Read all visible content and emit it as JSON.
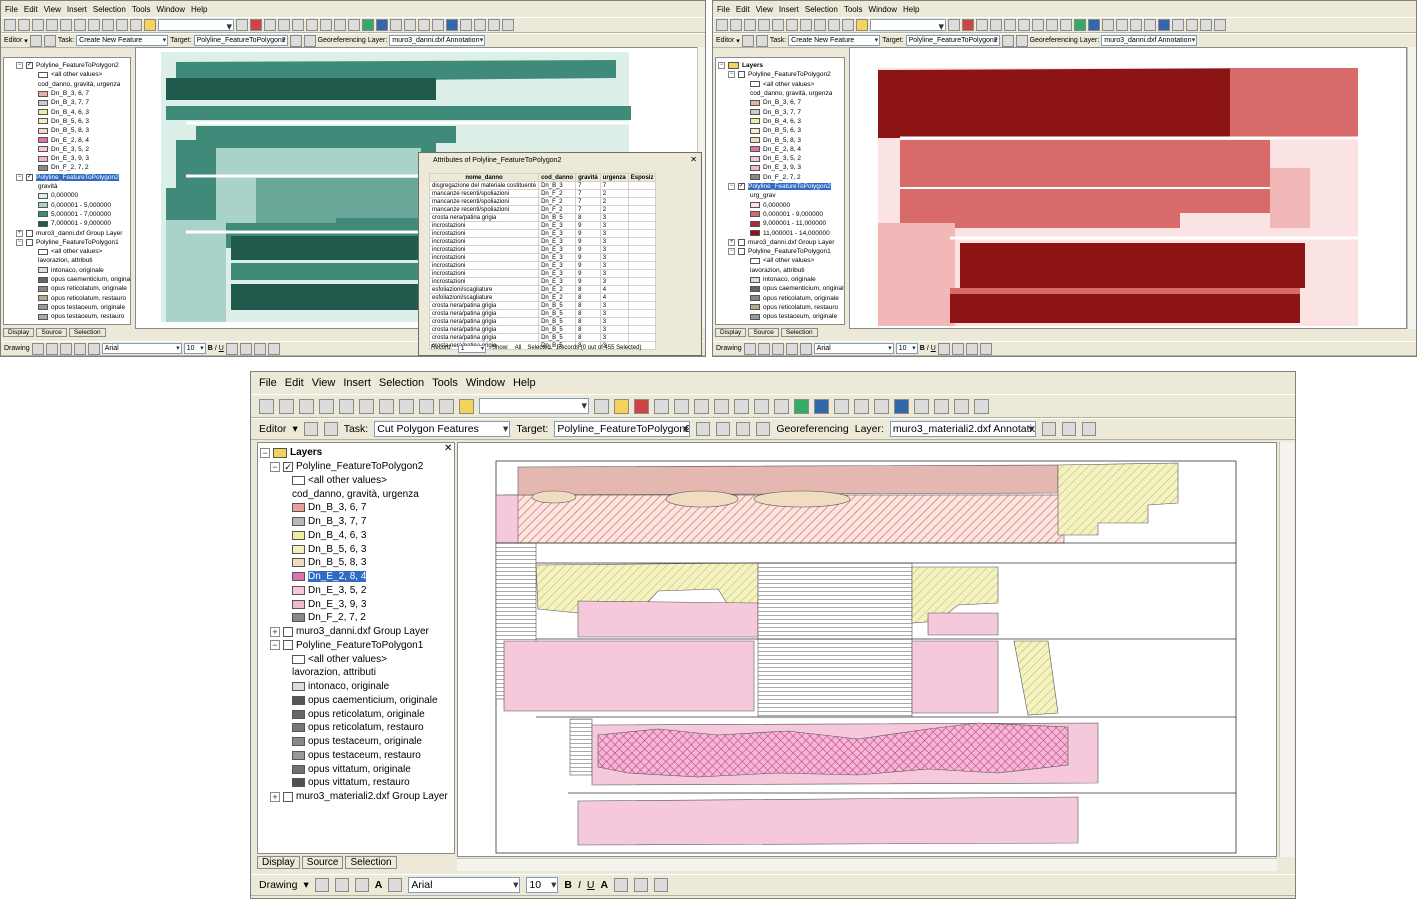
{
  "menu": [
    "File",
    "Edit",
    "View",
    "Insert",
    "Selection",
    "Tools",
    "Window",
    "Help"
  ],
  "colors": {
    "teal_dark": "#1f5a4c",
    "teal_mid": "#3f8a78",
    "teal_light": "#a9d3c9",
    "teal_pale": "#dcefe9",
    "red_dark": "#8c1414",
    "red_mid": "#d96a6a",
    "red_light": "#f2b8b8",
    "red_pale": "#fbe3e3",
    "pink": "#f6c8dc",
    "magenta": "#d0408c",
    "yellow": "#efeda0",
    "tan": "#f0dcc0",
    "hatch_red": "#d8746c"
  },
  "icons": [
    "new-icon",
    "open-icon",
    "save-icon",
    "print-icon",
    "cut-icon",
    "copy-icon",
    "paste-icon",
    "delete-icon",
    "undo-icon",
    "redo-icon",
    "add-data-icon",
    "editor-toolbar-icon",
    "arctoolbox-icon",
    "python-icon",
    "whats-this-icon",
    "zoom-in-icon",
    "zoom-out-icon",
    "fixed-zoom-in-icon",
    "fixed-zoom-out-icon",
    "pan-icon",
    "full-extent-icon",
    "back-icon",
    "forward-icon",
    "select-features-icon",
    "clear-selection-icon",
    "select-elements-icon",
    "identify-icon",
    "find-icon",
    "go-to-xy-icon",
    "measure-icon",
    "hyperlink-icon"
  ],
  "top_left": {
    "editor_label": "Editor",
    "task_label": "Task:",
    "task_value": "Create New Feature",
    "target_label": "Target:",
    "target_value": "Polyline_FeatureToPolygon2",
    "georef": "Georeferencing",
    "layer_label": "Layer:",
    "layer_value": "muro3_danni.dxf Annotation",
    "toc": [
      {
        "label": "Polyline_FeatureToPolygon2",
        "kind": "group",
        "expand": "−",
        "checked": true
      },
      {
        "label": "<all other values>",
        "kind": "sym",
        "color": "#ffffff"
      },
      {
        "label": "cod_danno, gravità, urgenza",
        "kind": "text"
      },
      {
        "label": "Dn_B_3, 6, 7",
        "kind": "sym",
        "color": "#e8b0a8"
      },
      {
        "label": "Dn_B_3, 7, 7",
        "kind": "sym",
        "color": "#cccccc"
      },
      {
        "label": "Dn_B_4, 6, 3",
        "kind": "sym",
        "color": "#efeda0"
      },
      {
        "label": "Dn_B_5, 6, 3",
        "kind": "sym",
        "color": "#f4eec0"
      },
      {
        "label": "Dn_B_5, 8, 3",
        "kind": "sym",
        "color": "#f0dcc0"
      },
      {
        "label": "Dn_E_2, 8, 4",
        "kind": "sym",
        "color": "#e070a8"
      },
      {
        "label": "Dn_E_3, 5, 2",
        "kind": "sym",
        "color": "#f6c8dc"
      },
      {
        "label": "Dn_E_3, 9, 3",
        "kind": "sym",
        "color": "#f2b8cc"
      },
      {
        "label": "Dn_F_2, 7, 2",
        "kind": "sym",
        "color": "#888888"
      },
      {
        "label": "Polyline_FeatureToPolygon2",
        "kind": "group",
        "expand": "−",
        "checked": true,
        "selected": true
      },
      {
        "label": "gravità",
        "kind": "text"
      },
      {
        "label": "0,000000",
        "kind": "sym",
        "color": "#dcefe9"
      },
      {
        "label": "0,000001 - 5,000000",
        "kind": "sym",
        "color": "#a9d3c9"
      },
      {
        "label": "5,000001 - 7,000000",
        "kind": "sym",
        "color": "#3f8a78"
      },
      {
        "label": "7,000001 - 9,000000",
        "kind": "sym",
        "color": "#1f5a4c"
      },
      {
        "label": "muro3_danni.dxf Group Layer",
        "kind": "group",
        "expand": "+",
        "checked": false
      },
      {
        "label": "Polyline_FeatureToPolygon1",
        "kind": "group",
        "expand": "−",
        "checked": false
      },
      {
        "label": "<all other values>",
        "kind": "sym",
        "color": "#ffffff"
      },
      {
        "label": "lavorazion, attributi",
        "kind": "text"
      },
      {
        "label": "intonaco, originale",
        "kind": "sym",
        "color": "#dddddd"
      },
      {
        "label": "opus caementicium, originale",
        "kind": "sym",
        "color": "#666666"
      },
      {
        "label": "opus reticolatum, originale",
        "kind": "sym",
        "color": "#888888"
      },
      {
        "label": "opus reticolatum, restauro",
        "kind": "sym",
        "color": "#b8a890"
      },
      {
        "label": "opus testaceum, originale",
        "kind": "sym",
        "color": "#999999"
      },
      {
        "label": "opus testaceum, restauro",
        "kind": "sym",
        "color": "#aaaaaa"
      }
    ],
    "tabs": [
      "Display",
      "Source",
      "Selection"
    ],
    "drawing_label": "Drawing",
    "font_value": "Arial",
    "size_value": "10"
  },
  "attributes": {
    "title": "Attributes of Polyline_FeatureToPolygon2",
    "columns": [
      "nome_danno",
      "cod_danno",
      "gravità",
      "urgenza",
      "Esposiz"
    ],
    "rows": [
      [
        "disgregazione del materiale costituente",
        "Dn_B_3",
        "7",
        "7",
        ""
      ],
      [
        "mancanze recenti/spoliazioni",
        "Dn_F_2",
        "7",
        "2",
        ""
      ],
      [
        "mancanze recenti/spoliazioni",
        "Dn_F_2",
        "7",
        "2",
        ""
      ],
      [
        "mancanze recenti/spoliazioni",
        "Dn_F_2",
        "7",
        "2",
        ""
      ],
      [
        "crosta nera/patina grigia",
        "Dn_B_5",
        "8",
        "3",
        ""
      ],
      [
        "incrostazioni",
        "Dn_E_3",
        "9",
        "3",
        ""
      ],
      [
        "incrostazioni",
        "Dn_E_3",
        "9",
        "3",
        ""
      ],
      [
        "incrostazioni",
        "Dn_E_3",
        "9",
        "3",
        ""
      ],
      [
        "incrostazioni",
        "Dn_E_3",
        "9",
        "3",
        ""
      ],
      [
        "incrostazioni",
        "Dn_E_3",
        "9",
        "3",
        ""
      ],
      [
        "incrostazioni",
        "Dn_E_3",
        "9",
        "3",
        ""
      ],
      [
        "incrostazioni",
        "Dn_E_3",
        "9",
        "3",
        ""
      ],
      [
        "incrostazioni",
        "Dn_E_3",
        "9",
        "3",
        ""
      ],
      [
        "esfoliazioni/scagliature",
        "Dn_E_2",
        "8",
        "4",
        ""
      ],
      [
        "esfoliazioni/scagliature",
        "Dn_E_2",
        "8",
        "4",
        ""
      ],
      [
        "crosta nera/patina grigia",
        "Dn_B_5",
        "8",
        "3",
        ""
      ],
      [
        "crosta nera/patina grigia",
        "Dn_B_5",
        "8",
        "3",
        ""
      ],
      [
        "crosta nera/patina grigia",
        "Dn_B_5",
        "8",
        "3",
        ""
      ],
      [
        "crosta nera/patina grigia",
        "Dn_B_5",
        "8",
        "3",
        ""
      ],
      [
        "crosta nera/patina grigia",
        "Dn_B_5",
        "8",
        "3",
        ""
      ],
      [
        "crosta nera/patina grigia",
        "Dn_B_5",
        "8",
        "3",
        ""
      ]
    ],
    "record_label": "Record:",
    "record_value": "1",
    "show_label": "Show:",
    "show_all": "All",
    "show_selected": "Selected",
    "records_text": "Records (0 out of 455 Selected)"
  },
  "top_right": {
    "editor_label": "Editor",
    "task_label": "Task:",
    "task_value": "Create New Feature",
    "target_label": "Target:",
    "target_value": "Polyline_FeatureToPolygon2",
    "georef": "Georeferencing",
    "layer_label": "Layer:",
    "layer_value": "muro3_danni.dxf Annotation",
    "toc": [
      {
        "label": "Layers",
        "kind": "root",
        "expand": "−"
      },
      {
        "label": "Polyline_FeatureToPolygon2",
        "kind": "group",
        "expand": "−",
        "checked": false
      },
      {
        "label": "<all other values>",
        "kind": "sym",
        "color": "#ffffff"
      },
      {
        "label": "cod_danno, gravità, urgenza",
        "kind": "text"
      },
      {
        "label": "Dn_B_3, 6, 7",
        "kind": "sym",
        "color": "#e8b0a8"
      },
      {
        "label": "Dn_B_3, 7, 7",
        "kind": "sym",
        "color": "#cccccc"
      },
      {
        "label": "Dn_B_4, 6, 3",
        "kind": "sym",
        "color": "#efeda0"
      },
      {
        "label": "Dn_B_5, 6, 3",
        "kind": "sym",
        "color": "#f4eec0"
      },
      {
        "label": "Dn_B_5, 8, 3",
        "kind": "sym",
        "color": "#f0dcc0"
      },
      {
        "label": "Dn_E_2, 8, 4",
        "kind": "sym",
        "color": "#e070a8"
      },
      {
        "label": "Dn_E_3, 5, 2",
        "kind": "sym",
        "color": "#f6c8dc"
      },
      {
        "label": "Dn_E_3, 9, 3",
        "kind": "sym",
        "color": "#f2b8cc"
      },
      {
        "label": "Dn_F_2, 7, 2",
        "kind": "sym",
        "color": "#888888"
      },
      {
        "label": "Polyline_FeatureToPolygon2",
        "kind": "group",
        "expand": "−",
        "checked": true,
        "selected": true
      },
      {
        "label": "urg_grav",
        "kind": "text"
      },
      {
        "label": "0,000000",
        "kind": "sym",
        "color": "#fbe3e3"
      },
      {
        "label": "0,000001 - 9,000000",
        "kind": "sym",
        "color": "#d96a6a"
      },
      {
        "label": "9,000001 - 11,000000",
        "kind": "sym",
        "color": "#b02a2a"
      },
      {
        "label": "11,000001 - 14,000000",
        "kind": "sym",
        "color": "#8c1414"
      },
      {
        "label": "muro3_danni.dxf Group Layer",
        "kind": "group",
        "expand": "+",
        "checked": false
      },
      {
        "label": "Polyline_FeatureToPolygon1",
        "kind": "group",
        "expand": "−",
        "checked": false
      },
      {
        "label": "<all other values>",
        "kind": "sym",
        "color": "#ffffff"
      },
      {
        "label": "lavorazion, attributi",
        "kind": "text"
      },
      {
        "label": "intonaco, originale",
        "kind": "sym",
        "color": "#dddddd"
      },
      {
        "label": "opus caementicium, originale",
        "kind": "sym",
        "color": "#666666"
      },
      {
        "label": "opus reticolatum, originale",
        "kind": "sym",
        "color": "#888888"
      },
      {
        "label": "opus reticolatum, restauro",
        "kind": "sym",
        "color": "#b8a890"
      },
      {
        "label": "opus testaceum, originale",
        "kind": "sym",
        "color": "#999999"
      }
    ],
    "tabs": [
      "Display",
      "Source",
      "Selection"
    ],
    "drawing_label": "Drawing",
    "font_value": "Arial",
    "size_value": "10"
  },
  "bottom": {
    "editor_label": "Editor",
    "task_label": "Task:",
    "task_value": "Cut Polygon Features",
    "target_label": "Target:",
    "target_value": "Polyline_FeatureToPolygon2",
    "georef": "Georeferencing",
    "layer_label": "Layer:",
    "layer_value": "muro3_materiali2.dxf Annotation",
    "toc": [
      {
        "label": "Layers",
        "kind": "root",
        "expand": "−"
      },
      {
        "label": "Polyline_FeatureToPolygon2",
        "kind": "group",
        "expand": "−",
        "checked": true
      },
      {
        "label": "<all other values>",
        "kind": "sym",
        "color": "#ffffff"
      },
      {
        "label": "cod_danno, gravità, urgenza",
        "kind": "text"
      },
      {
        "label": "Dn_B_3, 6, 7",
        "kind": "sym",
        "color": "#e8a098"
      },
      {
        "label": "Dn_B_3, 7, 7",
        "kind": "sym",
        "color": "#b8b8b8"
      },
      {
        "label": "Dn_B_4, 6, 3",
        "kind": "sym",
        "color": "#efeda0"
      },
      {
        "label": "Dn_B_5, 6, 3",
        "kind": "sym",
        "color": "#f4eec0"
      },
      {
        "label": "Dn_B_5, 8, 3",
        "kind": "sym",
        "color": "#f0dcc0"
      },
      {
        "label": "Dn_E_2, 8, 4",
        "kind": "sym",
        "color": "#e070a8",
        "selected": true
      },
      {
        "label": "Dn_E_3, 5, 2",
        "kind": "sym",
        "color": "#f6c8dc"
      },
      {
        "label": "Dn_E_3, 9, 3",
        "kind": "sym",
        "color": "#f2b8cc"
      },
      {
        "label": "Dn_F_2, 7, 2",
        "kind": "sym",
        "color": "#888888"
      },
      {
        "label": "muro3_danni.dxf Group Layer",
        "kind": "group",
        "expand": "+",
        "checked": false
      },
      {
        "label": "Polyline_FeatureToPolygon1",
        "kind": "group",
        "expand": "−",
        "checked": false
      },
      {
        "label": "<all other values>",
        "kind": "sym",
        "color": "#ffffff"
      },
      {
        "label": "lavorazion, attributi",
        "kind": "text"
      },
      {
        "label": "intonaco, originale",
        "kind": "sym",
        "color": "#dddddd"
      },
      {
        "label": "opus caementicium, originale",
        "kind": "sym",
        "color": "#555555"
      },
      {
        "label": "opus reticolatum, originale",
        "kind": "sym",
        "color": "#666666"
      },
      {
        "label": "opus reticolatum, restauro",
        "kind": "sym",
        "color": "#777777"
      },
      {
        "label": "opus testaceum, originale",
        "kind": "sym",
        "color": "#888888"
      },
      {
        "label": "opus testaceum, restauro",
        "kind": "sym",
        "color": "#999999"
      },
      {
        "label": "opus vittatum, originale",
        "kind": "sym",
        "color": "#707070"
      },
      {
        "label": "opus vittatum, restauro",
        "kind": "sym",
        "color": "#505050"
      },
      {
        "label": "muro3_materiali2.dxf Group Layer",
        "kind": "group",
        "expand": "+",
        "checked": false
      }
    ],
    "tabs": [
      "Display",
      "Source",
      "Selection"
    ],
    "drawing_label": "Drawing",
    "font_value": "Arial",
    "size_value": "10"
  }
}
